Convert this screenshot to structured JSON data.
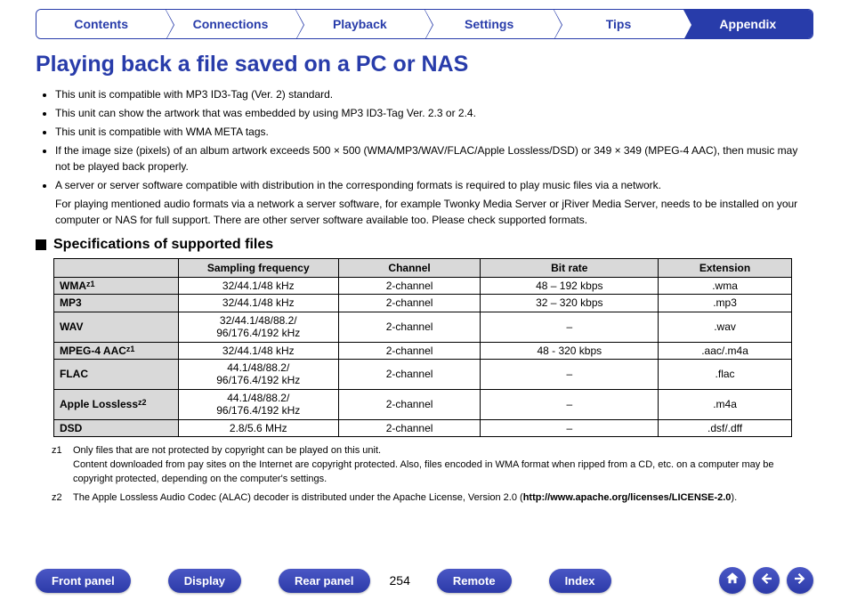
{
  "top_tabs": {
    "items": [
      {
        "label": "Contents",
        "active": false
      },
      {
        "label": "Connections",
        "active": false
      },
      {
        "label": "Playback",
        "active": false
      },
      {
        "label": "Settings",
        "active": false
      },
      {
        "label": "Tips",
        "active": false
      },
      {
        "label": "Appendix",
        "active": true
      }
    ]
  },
  "title": "Playing back a file saved on a PC or NAS",
  "bullets": [
    "This unit is compatible with MP3 ID3-Tag (Ver. 2) standard.",
    "This unit can show the artwork that was embedded by using MP3 ID3-Tag Ver. 2.3 or 2.4.",
    "This unit is compatible with WMA META tags.",
    "If the image size (pixels) of an album artwork exceeds 500 × 500 (WMA/MP3/WAV/FLAC/Apple Lossless/DSD) or 349 × 349 (MPEG-4 AAC), then music may not be played back properly.",
    "A server or server software compatible with distribution in the corresponding formats is required to play music files via a network."
  ],
  "bullet_sub": "For playing mentioned audio formats via a network a server software, for example Twonky Media Server or jRiver Media Server, needs to be installed on your computer or NAS for full support. There are other server software available too. Please check supported formats.",
  "section_heading": "Specifications of supported files",
  "table": {
    "headers": [
      "",
      "Sampling frequency",
      "Channel",
      "Bit rate",
      "Extension"
    ],
    "rows": [
      {
        "format": "WMA",
        "note": "z1",
        "sampling": "32/44.1/48 kHz",
        "channel": "2-channel",
        "bitrate": "48 – 192 kbps",
        "ext": ".wma"
      },
      {
        "format": "MP3",
        "note": "",
        "sampling": "32/44.1/48 kHz",
        "channel": "2-channel",
        "bitrate": "32 – 320 kbps",
        "ext": ".mp3"
      },
      {
        "format": "WAV",
        "note": "",
        "sampling": "32/44.1/48/88.2/\n96/176.4/192 kHz",
        "channel": "2-channel",
        "bitrate": "–",
        "ext": ".wav"
      },
      {
        "format": "MPEG-4 AAC",
        "note": "z1",
        "sampling": "32/44.1/48 kHz",
        "channel": "2-channel",
        "bitrate": "48 - 320 kbps",
        "ext": ".aac/.m4a"
      },
      {
        "format": "FLAC",
        "note": "",
        "sampling": "44.1/48/88.2/\n96/176.4/192 kHz",
        "channel": "2-channel",
        "bitrate": "–",
        "ext": ".flac"
      },
      {
        "format": "Apple Lossless",
        "note": "z2",
        "sampling": "44.1/48/88.2/\n96/176.4/192 kHz",
        "channel": "2-channel",
        "bitrate": "–",
        "ext": ".m4a"
      },
      {
        "format": "DSD",
        "note": "",
        "sampling": "2.8/5.6 MHz",
        "channel": "2-channel",
        "bitrate": "–",
        "ext": ".dsf/.dff"
      }
    ]
  },
  "footnotes": [
    {
      "label": "z1",
      "text": "Only files that are not protected by copyright can be played on this unit.\nContent downloaded from pay sites on the Internet are copyright protected. Also, files encoded in WMA format when ripped from a CD, etc. on a computer may be copyright protected, depending on the computer's settings."
    },
    {
      "label": "z2",
      "text": "The Apple Lossless Audio Codec (ALAC) decoder is distributed under the Apache License, Version 2.0 (",
      "bold": "http://www.apache.org/licenses/LICENSE-2.0",
      "after": ")."
    }
  ],
  "bottom_buttons": [
    "Front panel",
    "Display",
    "Rear panel"
  ],
  "page_number": "254",
  "bottom_buttons_right": [
    "Remote",
    "Index"
  ],
  "icons": {
    "home": "home-icon",
    "prev": "arrow-left-icon",
    "next": "arrow-right-icon"
  }
}
